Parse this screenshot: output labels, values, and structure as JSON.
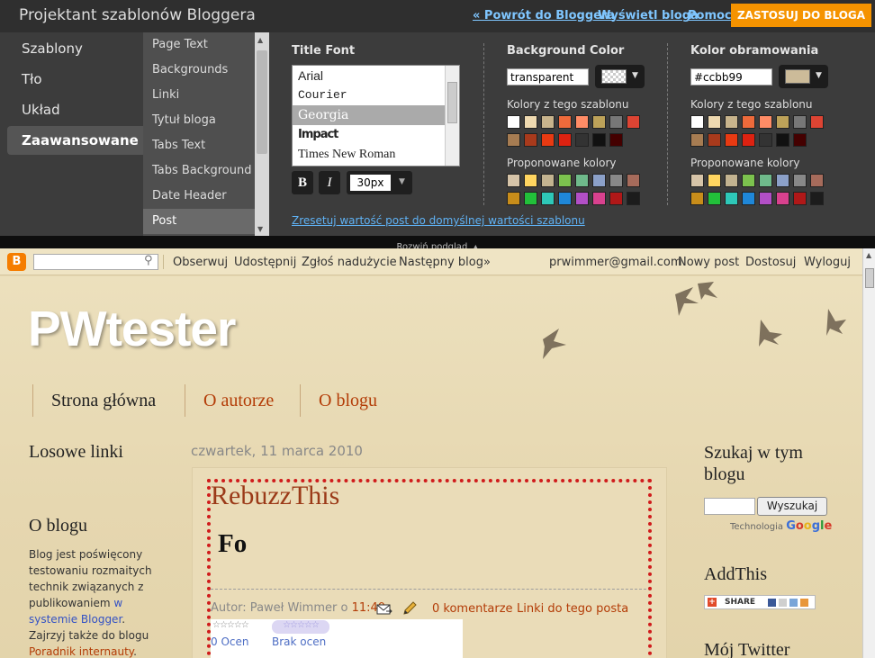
{
  "designer": {
    "title": "Projektant szablonów Bloggera",
    "links": {
      "back": "« Powrót do Bloggera",
      "view": "Wyświetl bloga",
      "help": "Pomoc"
    },
    "apply_label": "ZASTOSUJ DO BLOGA",
    "left_nav": [
      "Szablony",
      "Tło",
      "Układ",
      "Zaawansowane"
    ],
    "left_nav_active": "Zaawansowane",
    "sub_nav": [
      "Page Text",
      "Backgrounds",
      "Linki",
      "Tytuł bloga",
      "Tabs Text",
      "Tabs Background",
      "Date Header",
      "Post"
    ],
    "sub_nav_active": "Post",
    "title_font": {
      "label": "Title Font",
      "fonts": [
        "Arial",
        "Courier",
        "Georgia",
        "Impact",
        "Times New Roman"
      ],
      "selected": "Georgia",
      "bold_label": "B",
      "italic_label": "I",
      "size": "30px"
    },
    "background_color": {
      "label": "Background Color",
      "value": "transparent",
      "template_label": "Kolory z tego szablonu",
      "suggested_label": "Proponowane kolory"
    },
    "border_color": {
      "label": "Kolor obramowania",
      "value": "#ccbb99",
      "swatch": "#ccbb99",
      "template_label": "Kolory z tego szablonu",
      "suggested_label": "Proponowane kolory"
    },
    "template_colors": [
      "#ffffff",
      "#eed9b0",
      "#c8b48c",
      "#ee6a3b",
      "#ff8c66",
      "#bda259",
      "#777777",
      "#dd4433",
      "#a67c52",
      "#a83a1c",
      "#e83a12",
      "#dd2211",
      "#333333",
      "#111111",
      "#440000"
    ],
    "suggested_colors": [
      "#d6c4a8",
      "#ffd560",
      "#c3b390",
      "#7cc24e",
      "#6fba8b",
      "#8ba0c8",
      "#888888",
      "#a66b5b",
      "#c88d1a",
      "#22c03a",
      "#2ec8b8",
      "#1f87d8",
      "#b24fc6",
      "#d8418e",
      "#b01818",
      "#1c1c1c"
    ],
    "reset_link": "Zresetuj wartość post do domyślnej wartości szablonu",
    "expand_label": "Rozwiń podgląd"
  },
  "blogger_navbar": {
    "logo": "B",
    "links": [
      "Obserwuj",
      "Udostępnij",
      "Zgłoś nadużycie",
      "Następny blog»"
    ],
    "email": "prwimmer@gmail.com",
    "right_links": [
      "Nowy post",
      "Dostosuj",
      "Wyloguj"
    ]
  },
  "blog": {
    "title": "PWtester",
    "tabs": [
      "Strona główna",
      "O autorze",
      "O blogu"
    ],
    "left_sidebar": {
      "random_links_title": "Losowe linki",
      "about_title": "O blogu",
      "about_text_1": "Blog jest poświęcony testowaniu rozmaitych technik związanych z publikowaniem ",
      "about_link_1": "w systemie Blogger",
      "about_text_2": ". Zajrzyj także do blogu ",
      "about_link_2": "Poradnik internauty",
      "about_text_3": "."
    },
    "post": {
      "date": "czwartek, 11 marca 2010",
      "title": "RebuzzThis",
      "body": "Fo",
      "author_prefix": "Autor: Paweł Wimmer o ",
      "time": "11:40",
      "comments": "0 komentarze",
      "links": "Linki do tego posta",
      "rating_count_1": "0 Ocen",
      "rating_count_2": "Brak ocen"
    },
    "right_sidebar": {
      "search_title": "Szukaj w tym blogu",
      "search_button": "Wyszukaj",
      "powered_by": "Technologia ",
      "google": "Google",
      "addthis_title": "AddThis",
      "addthis_button": "SHARE",
      "twitter_title": "Mój Twitter"
    }
  }
}
